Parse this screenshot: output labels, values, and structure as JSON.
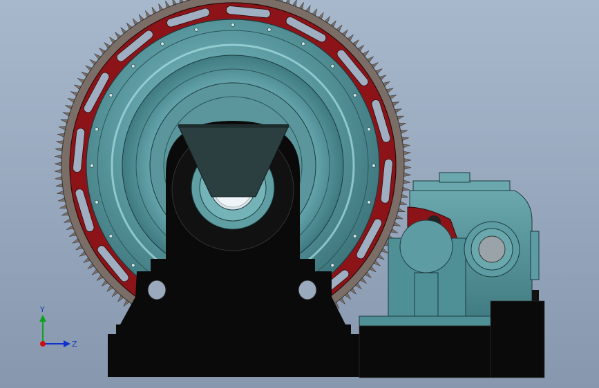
{
  "triad": {
    "y_label": "Y",
    "z_label": "Z",
    "x_color": "#d01010",
    "y_color": "#10a020",
    "z_color": "#1030d0"
  },
  "colors": {
    "background_top": "#a8b8cc",
    "background_bottom": "#8797ae",
    "gear_teeth": "#7a6e67",
    "gear_web": "#8c1418",
    "shell": "#5f9ea3",
    "base": "#0a0a0a",
    "gearbox": "#4f8f96"
  }
}
